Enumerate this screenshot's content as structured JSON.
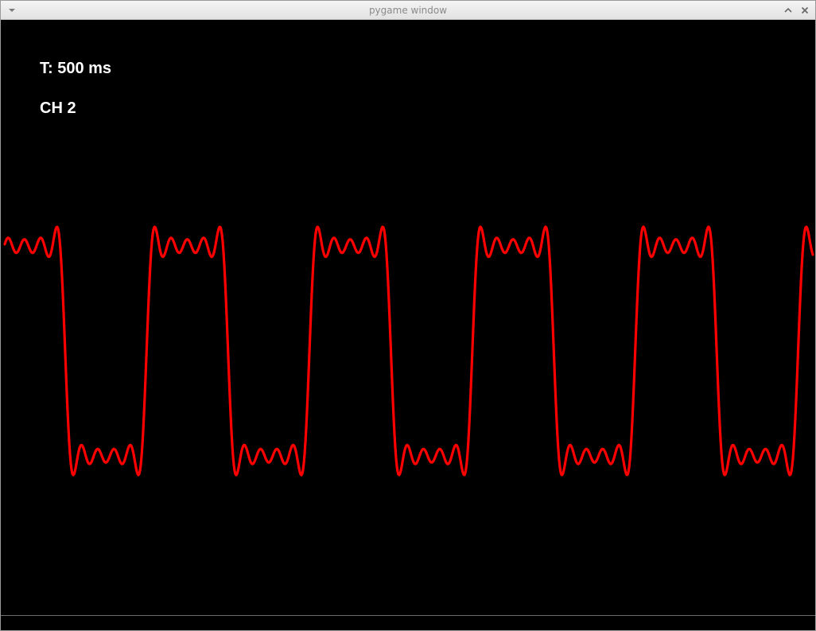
{
  "window": {
    "title": "pygame window"
  },
  "hud": {
    "period_label": "T: 500 ms",
    "channel_label": "CH 2"
  },
  "waveform": {
    "color": "#ff0000",
    "background": "#000000",
    "periods_visible": 5,
    "phase_cycles": 0.105,
    "harmonics": [
      1,
      3,
      5,
      7,
      9
    ]
  }
}
